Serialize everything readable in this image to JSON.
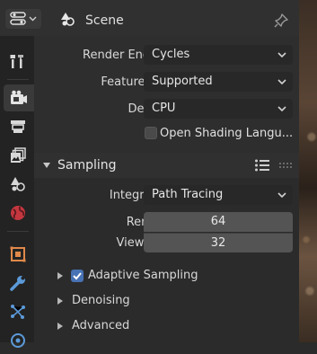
{
  "header": {
    "title": "Scene",
    "editor_icon": "properties-editor-icon",
    "context_icon": "scene-icon",
    "pin_icon": "pin-icon"
  },
  "tabs": [
    {
      "name": "tool",
      "icon": "tool-icon"
    },
    {
      "name": "render",
      "icon": "render-camera-icon",
      "active": true
    },
    {
      "name": "output",
      "icon": "output-printer-icon"
    },
    {
      "name": "view-layer",
      "icon": "view-layer-icon"
    },
    {
      "name": "scene",
      "icon": "scene-icon"
    },
    {
      "name": "world",
      "icon": "world-icon"
    },
    {
      "name": "object",
      "icon": "object-icon"
    },
    {
      "name": "modifiers",
      "icon": "wrench-icon"
    },
    {
      "name": "particles",
      "icon": "particles-icon"
    },
    {
      "name": "physics",
      "icon": "physics-icon"
    }
  ],
  "render": {
    "engine_label": "Render Engine",
    "engine_value": "Cycles",
    "feature_label": "Feature Set",
    "feature_value": "Supported",
    "device_label": "Device",
    "device_value": "CPU",
    "osl_label": "Open Shading Langu...",
    "osl_checked": false
  },
  "sampling": {
    "title": "Sampling",
    "integrator_label": "Integrator",
    "integrator_value": "Path Tracing",
    "render_label": "Render",
    "render_value": "64",
    "viewport_label": "Viewport",
    "viewport_value": "32",
    "adaptive_label": "Adaptive Sampling",
    "adaptive_checked": true,
    "denoising_label": "Denoising",
    "advanced_label": "Advanced"
  },
  "colors": {
    "accent": "#4772b3",
    "field": "#545454",
    "dropdown": "#282828"
  }
}
